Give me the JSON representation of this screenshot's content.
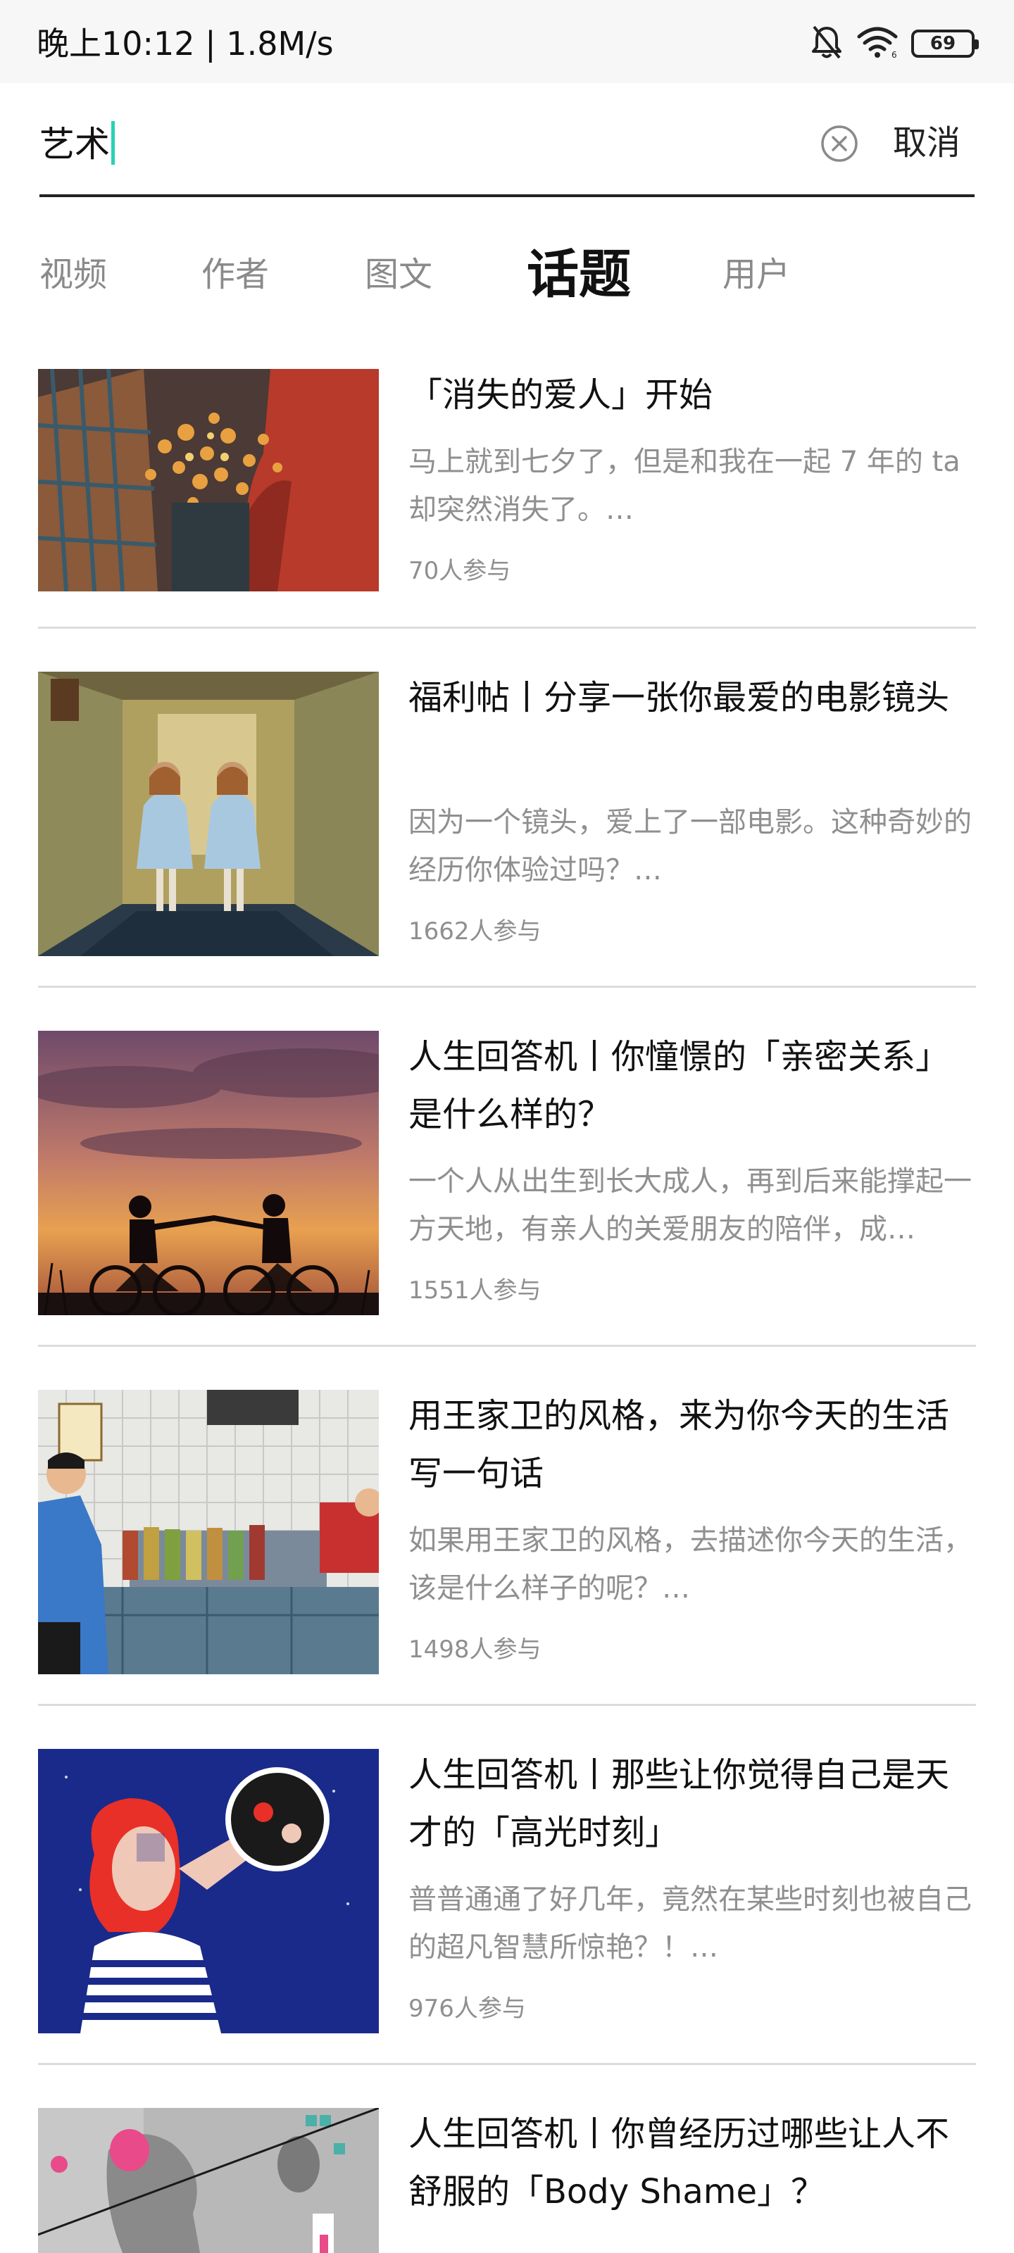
{
  "status_bar": {
    "time_speed": "晚上10:12 | 1.8M/s",
    "battery": "69",
    "icons": [
      "mute-bell-icon",
      "wifi-icon",
      "battery-icon"
    ]
  },
  "search": {
    "query": "艺术",
    "cancel_label": "取消",
    "accent_color": "#2ad1b4"
  },
  "tabs": [
    {
      "label": "视频",
      "active": false
    },
    {
      "label": "作者",
      "active": false
    },
    {
      "label": "图文",
      "active": false
    },
    {
      "label": "话题",
      "active": true
    },
    {
      "label": "用户",
      "active": false
    }
  ],
  "topics": [
    {
      "title": "「消失的爱人」开始",
      "desc": "马上就到七夕了，但是和我在一起 7 年的 ta 却突然消失了。…",
      "count": "70人参与"
    },
    {
      "title": "福利帖丨分享一张你最爱的电影镜头",
      "desc": "因为一个镜头，爱上了一部电影。这种奇妙的经历你体验过吗？…",
      "count": "1662人参与"
    },
    {
      "title": "人生回答机丨你憧憬的「亲密关系」是什么样的？",
      "desc": "一个人从出生到长大成人，再到后来能撑起一方天地，有亲人的关爱朋友的陪伴，成…",
      "count": "1551人参与"
    },
    {
      "title": "用王家卫的风格，来为你今天的生活写一句话",
      "desc": "如果用王家卫的风格，去描述你今天的生活，该是什么样子的呢？…",
      "count": "1498人参与"
    },
    {
      "title": "人生回答机丨那些让你觉得自己是天才的「高光时刻」",
      "desc": "普普通通了好几年，竟然在某些时刻也被自己的超凡智慧所惊艳？！…",
      "count": "976人参与"
    },
    {
      "title": "人生回答机丨你曾经历过哪些让人不舒服的「Body Shame」？",
      "desc": "",
      "count": ""
    }
  ]
}
